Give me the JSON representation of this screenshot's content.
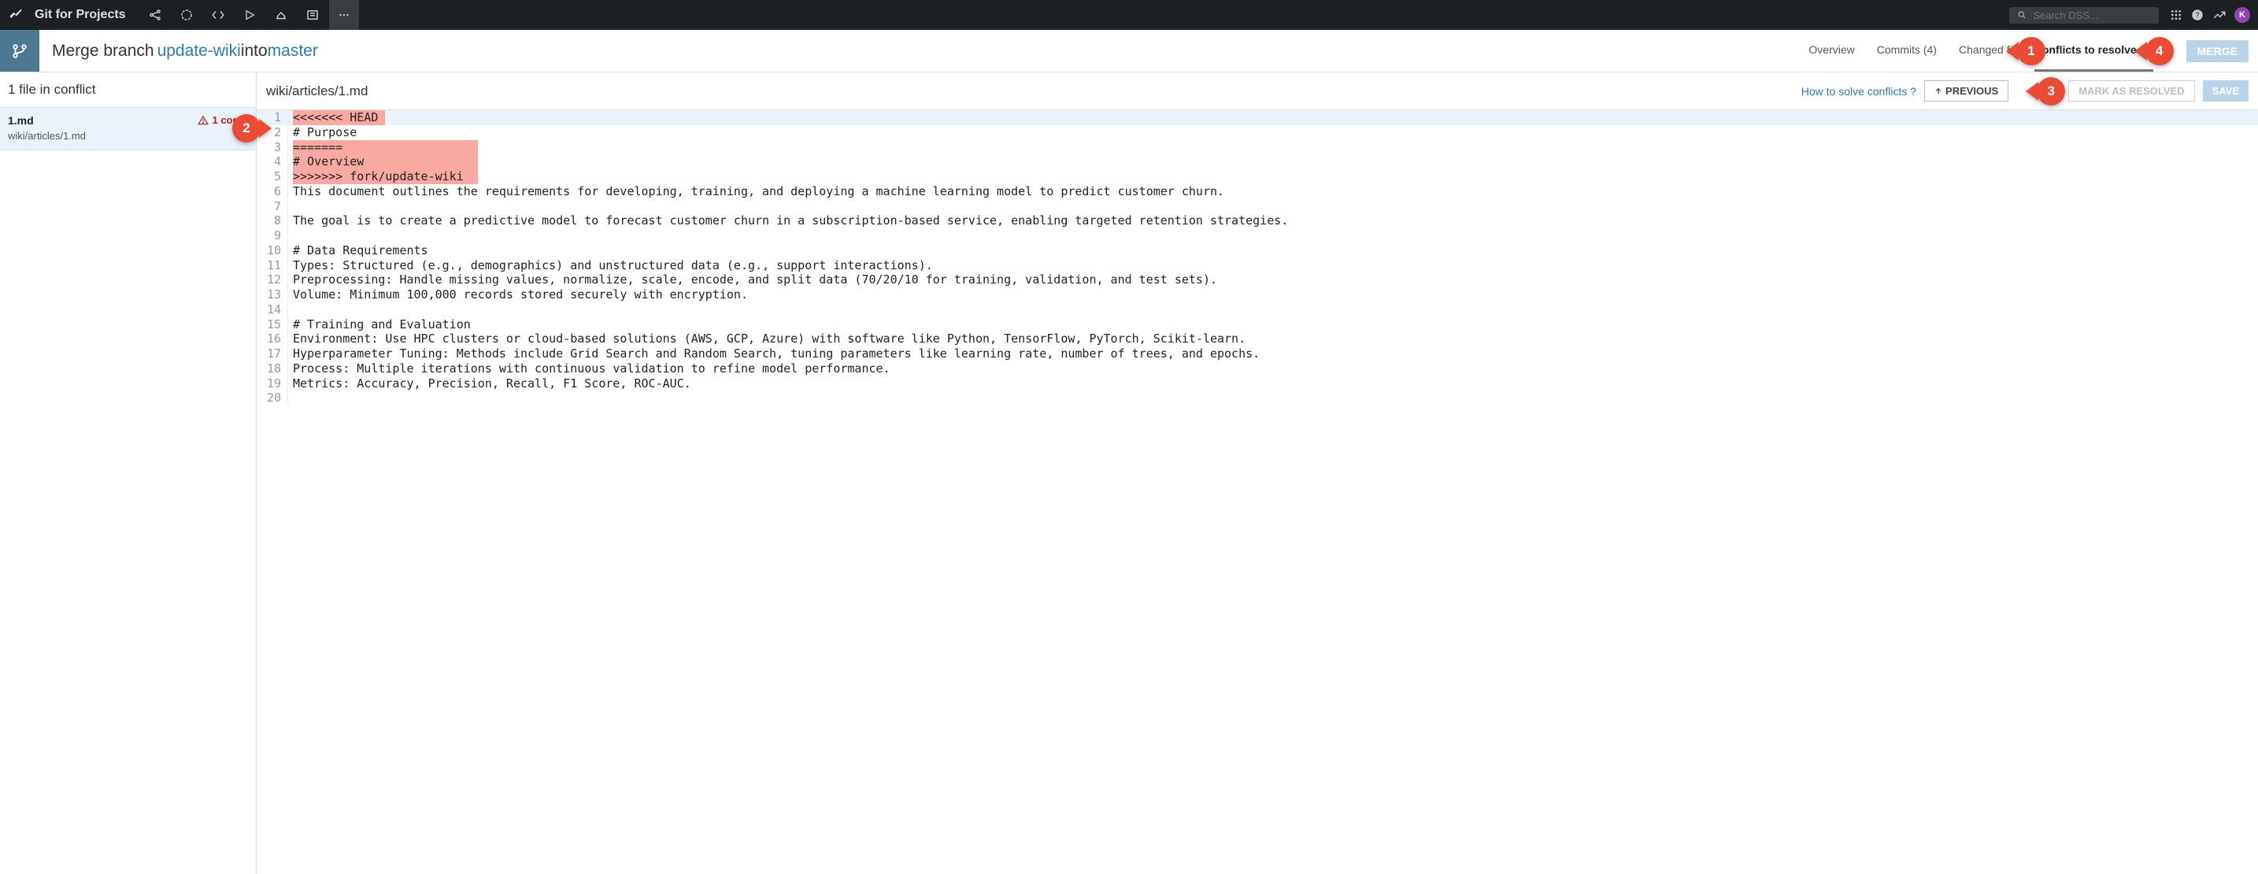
{
  "topbar": {
    "title": "Git for Projects",
    "search_placeholder": "Search DSS...",
    "avatar_letter": "K"
  },
  "merge_header": {
    "prefix": "Merge branch ",
    "source_branch": "update-wiki",
    "middle": " into ",
    "target_branch": "master"
  },
  "tabs": {
    "overview": "Overview",
    "commits": "Commits (4)",
    "changed_files_partial": "Changed fi",
    "conflicts": "Conflicts to resolve (1)"
  },
  "merge_button": "MERGE",
  "sidebar": {
    "header": "1 file in conflict",
    "file": {
      "name": "1.md",
      "path": "wiki/articles/1.md",
      "warning": "1 confli"
    }
  },
  "editor": {
    "path": "wiki/articles/1.md",
    "help": "How to solve conflicts ?",
    "prev_btn": "PREVIOUS",
    "next_hidden": "",
    "resolve_btn": "MARK AS RESOLVED",
    "save_btn": "SAVE"
  },
  "code": {
    "lines": [
      {
        "n": 1,
        "t": "<<<<<<< HEAD",
        "conflict": true,
        "cursor": true
      },
      {
        "n": 2,
        "t": "# Purpose",
        "conflict": false
      },
      {
        "n": 3,
        "t": "=======",
        "conflict": true,
        "wide": true
      },
      {
        "n": 4,
        "t": "# Overview",
        "conflict": true,
        "wide": true
      },
      {
        "n": 5,
        "t": ">>>>>>> fork/update-wiki",
        "conflict": true,
        "wide": true
      },
      {
        "n": 6,
        "t": "This document outlines the requirements for developing, training, and deploying a machine learning model to predict customer churn.",
        "conflict": false
      },
      {
        "n": 7,
        "t": "",
        "conflict": false
      },
      {
        "n": 8,
        "t": "The goal is to create a predictive model to forecast customer churn in a subscription-based service, enabling targeted retention strategies.",
        "conflict": false
      },
      {
        "n": 9,
        "t": "",
        "conflict": false
      },
      {
        "n": 10,
        "t": "# Data Requirements",
        "conflict": false
      },
      {
        "n": 11,
        "t": "Types: Structured (e.g., demographics) and unstructured data (e.g., support interactions).",
        "conflict": false
      },
      {
        "n": 12,
        "t": "Preprocessing: Handle missing values, normalize, scale, encode, and split data (70/20/10 for training, validation, and test sets).",
        "conflict": false
      },
      {
        "n": 13,
        "t": "Volume: Minimum 100,000 records stored securely with encryption.",
        "conflict": false
      },
      {
        "n": 14,
        "t": "",
        "conflict": false
      },
      {
        "n": 15,
        "t": "# Training and Evaluation",
        "conflict": false
      },
      {
        "n": 16,
        "t": "Environment: Use HPC clusters or cloud-based solutions (AWS, GCP, Azure) with software like Python, TensorFlow, PyTorch, Scikit-learn.",
        "conflict": false
      },
      {
        "n": 17,
        "t": "Hyperparameter Tuning: Methods include Grid Search and Random Search, tuning parameters like learning rate, number of trees, and epochs.",
        "conflict": false
      },
      {
        "n": 18,
        "t": "Process: Multiple iterations with continuous validation to refine model performance.",
        "conflict": false
      },
      {
        "n": 19,
        "t": "Metrics: Accuracy, Precision, Recall, F1 Score, ROC-AUC.",
        "conflict": false
      },
      {
        "n": 20,
        "t": "",
        "conflict": false
      }
    ]
  },
  "callouts": {
    "c1": "1",
    "c2": "2",
    "c3": "3",
    "c4": "4"
  }
}
